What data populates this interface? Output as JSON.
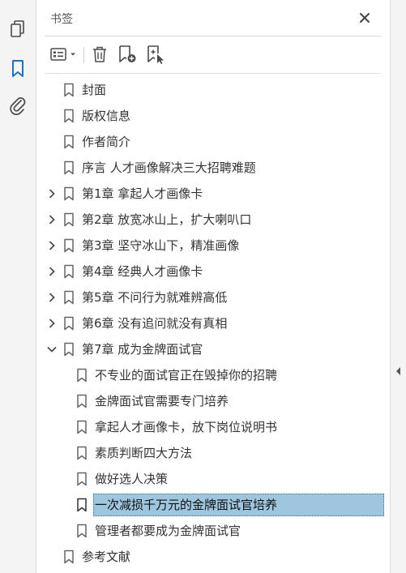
{
  "rail": {
    "icons": [
      "pages-icon",
      "bookmarks-icon",
      "attachments-icon"
    ]
  },
  "panel": {
    "title": "书签",
    "close_icon": "close-icon"
  },
  "toolbar": {
    "buttons": [
      "options-menu-icon",
      "delete-icon",
      "new-bookmark-icon",
      "bookmark-from-selection-icon"
    ]
  },
  "bookmarks": [
    {
      "label": "封面",
      "level": 0,
      "expander": "none"
    },
    {
      "label": "版权信息",
      "level": 0,
      "expander": "none"
    },
    {
      "label": "作者简介",
      "level": 0,
      "expander": "none"
    },
    {
      "label": "序言 人才画像解决三大招聘难题",
      "level": 0,
      "expander": "none"
    },
    {
      "label": "第1章 拿起人才画像卡",
      "level": 0,
      "expander": "collapsed"
    },
    {
      "label": "第2章 放宽冰山上，扩大喇叭口",
      "level": 0,
      "expander": "collapsed"
    },
    {
      "label": "第3章 坚守冰山下，精准画像",
      "level": 0,
      "expander": "collapsed"
    },
    {
      "label": "第4章 经典人才画像卡",
      "level": 0,
      "expander": "collapsed"
    },
    {
      "label": "第5章 不问行为就难辨高低",
      "level": 0,
      "expander": "collapsed"
    },
    {
      "label": "第6章 没有追问就没有真相",
      "level": 0,
      "expander": "collapsed"
    },
    {
      "label": "第7章 成为金牌面试官",
      "level": 0,
      "expander": "expanded"
    },
    {
      "label": "不专业的面试官正在毁掉你的招聘",
      "level": 1,
      "expander": "none"
    },
    {
      "label": "金牌面试官需要专门培养",
      "level": 1,
      "expander": "none"
    },
    {
      "label": "拿起人才画像卡，放下岗位说明书",
      "level": 1,
      "expander": "none"
    },
    {
      "label": "素质判断四大方法",
      "level": 1,
      "expander": "none"
    },
    {
      "label": "做好选人决策",
      "level": 1,
      "expander": "none"
    },
    {
      "label": "一次减损千万元的金牌面试官培养",
      "level": 1,
      "expander": "none",
      "selected": true
    },
    {
      "label": "管理者都要成为金牌面试官",
      "level": 1,
      "expander": "none"
    },
    {
      "label": "参考文献",
      "level": 0,
      "expander": "none"
    }
  ],
  "colors": {
    "accent": "#1a73c9",
    "selection": "#9ec6de",
    "icon": "#4a4a4a"
  }
}
